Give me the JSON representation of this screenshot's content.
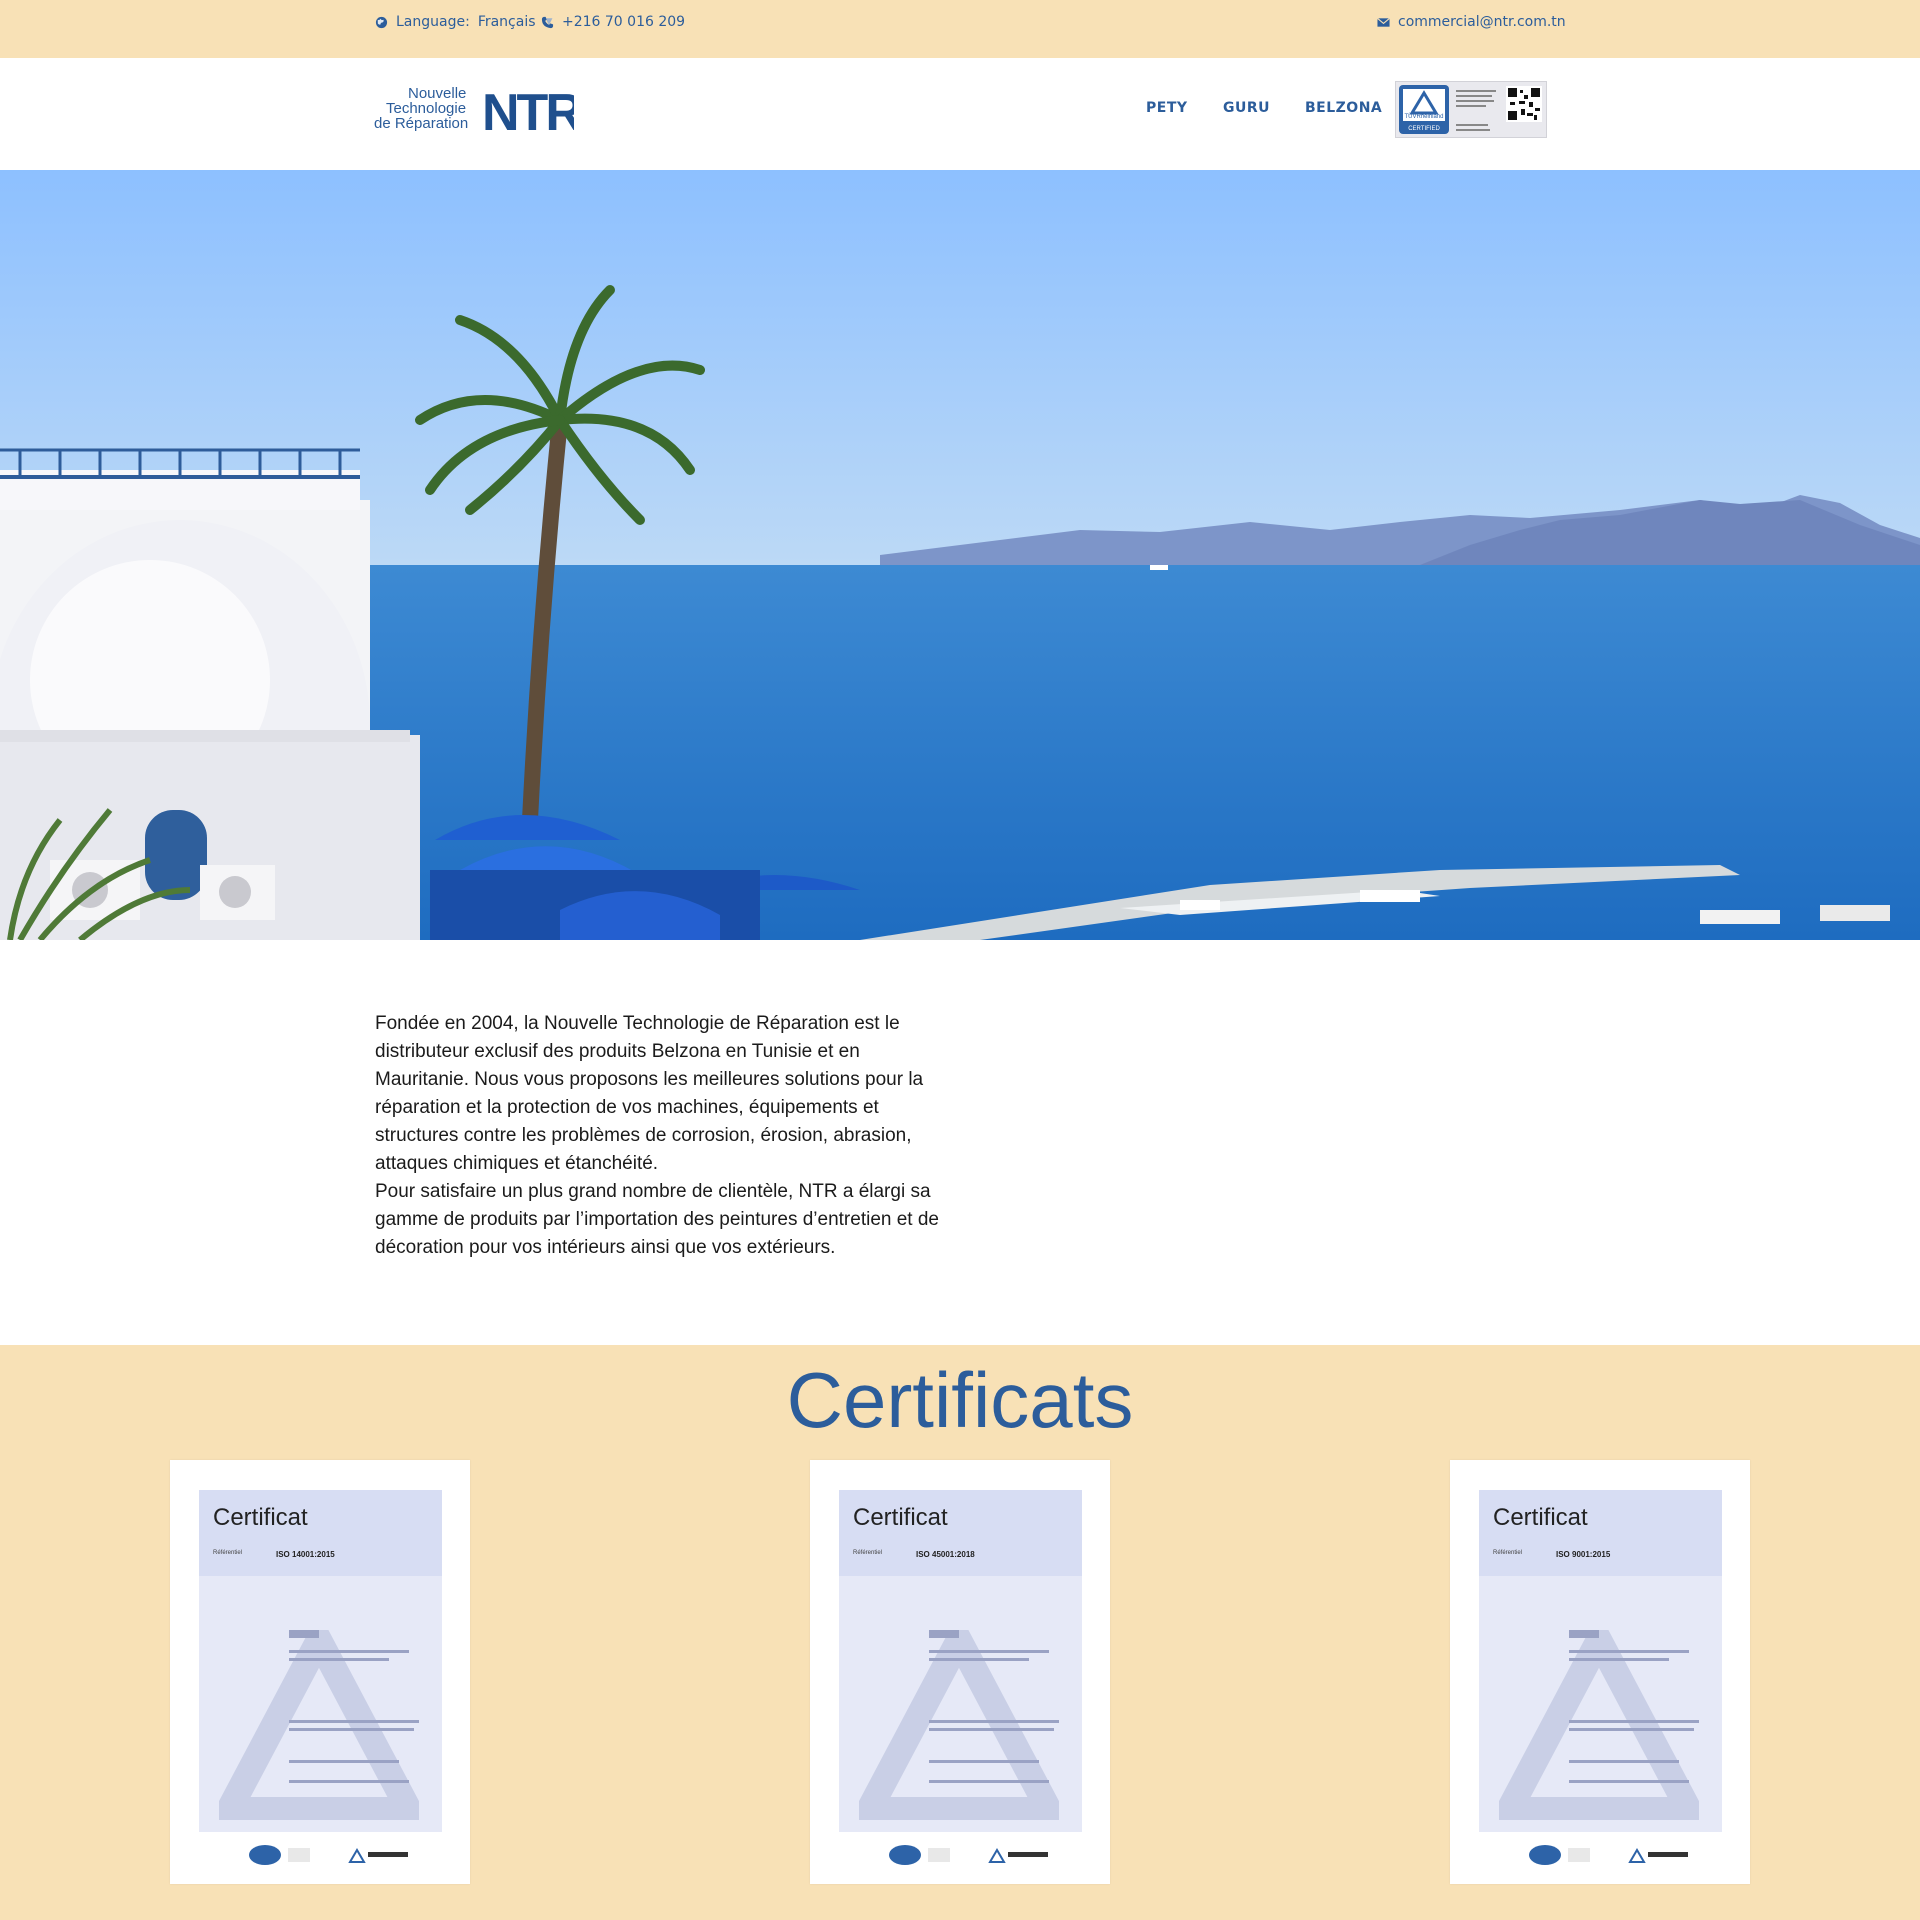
{
  "topbar": {
    "language_label": "Language:",
    "language_value": "Français",
    "phone": "+216 70 016 209",
    "email": "commercial@ntr.com.tn"
  },
  "header": {
    "logo_line1": "Nouvelle",
    "logo_line2": "Technologie",
    "logo_line3": "de Réparation",
    "logo_mark": "NTR",
    "nav": [
      "PETY",
      "GURU",
      "BELZONA"
    ],
    "badge_text": "TÜVRheinland",
    "badge_sub": "CERTIFIED"
  },
  "intro": {
    "p1": "Fondée en 2004, la Nouvelle Technologie de Réparation est le distributeur exclusif des produits Belzona en Tunisie et en Mauritanie. Nous vous proposons les meilleures solutions pour la réparation et la protection de vos machines, équipements et structures contre les problèmes de corrosion, érosion, abrasion, attaques chimiques et étanchéité.",
    "p2": "Pour satisfaire un plus grand nombre de clientèle, NTR a élargi sa gamme de produits par l’importation des peintures d’entretien et de décoration pour vos intérieurs ainsi que vos extérieurs."
  },
  "certificates": {
    "title": "Certificats",
    "items": [
      {
        "heading": "Certificat",
        "label": "Référentiel",
        "standard": "ISO 14001:2015"
      },
      {
        "heading": "Certificat",
        "label": "Référentiel",
        "standard": "ISO 45001:2018"
      },
      {
        "heading": "Certificat",
        "label": "Référentiel",
        "standard": "ISO 9001:2015"
      }
    ]
  },
  "colors": {
    "accent": "#2c5d9b",
    "topbar_bg": "#f8e1b6",
    "sky": "#9cc9ff",
    "sea": "#2a78c6"
  }
}
